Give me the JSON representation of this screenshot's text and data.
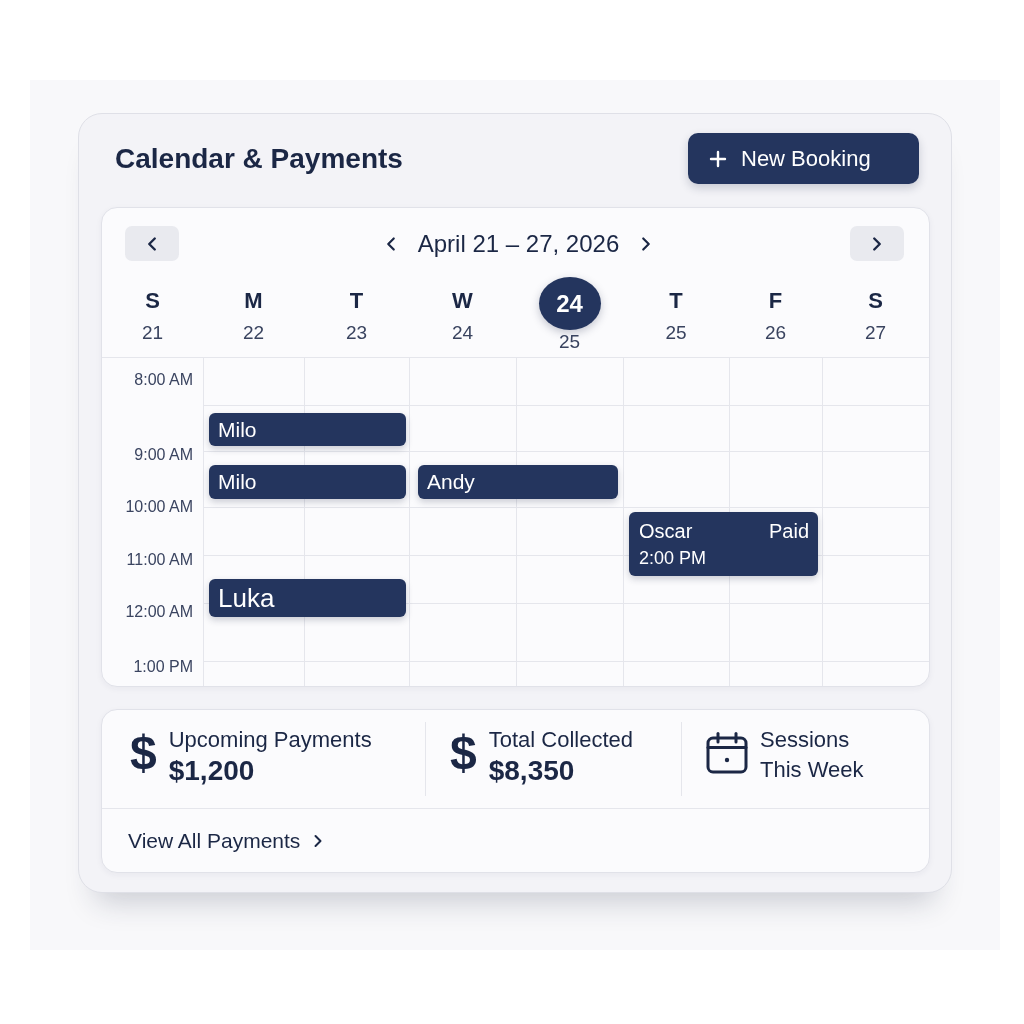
{
  "header": {
    "title": "Calendar & Payments",
    "new_booking_label": "New Booking"
  },
  "calendar": {
    "range_label": "April 21 – 27, 2026",
    "days": [
      {
        "label": "S",
        "date": "21",
        "selected": false
      },
      {
        "label": "M",
        "date": "22",
        "selected": false
      },
      {
        "label": "T",
        "date": "23",
        "selected": false
      },
      {
        "label": "W",
        "date": "24",
        "selected": false
      },
      {
        "label": "24",
        "date": "25",
        "selected": true
      },
      {
        "label": "T",
        "date": "25",
        "selected": false
      },
      {
        "label": "F",
        "date": "26",
        "selected": false
      },
      {
        "label": "S",
        "date": "27",
        "selected": false
      }
    ],
    "times": [
      "8:00 AM",
      "9:00 AM",
      "10:00 AM",
      "11:00 AM",
      "12:00 AM",
      "1:00 PM"
    ],
    "events": [
      {
        "name": "Milo"
      },
      {
        "name": "Milo"
      },
      {
        "name": "Andy"
      },
      {
        "name": "Oscar",
        "status": "Paid",
        "time": "2:00 PM"
      },
      {
        "name": "Luka"
      }
    ]
  },
  "summary": {
    "stats": [
      {
        "kind": "money",
        "symbol": "$",
        "label": "Upcoming Payments",
        "value": "$1,200"
      },
      {
        "kind": "money",
        "symbol": "$",
        "label": "Total Collected",
        "value": "$8,350"
      },
      {
        "kind": "calendar",
        "label": "Sessions This Week"
      }
    ],
    "link": "View All Payments"
  }
}
